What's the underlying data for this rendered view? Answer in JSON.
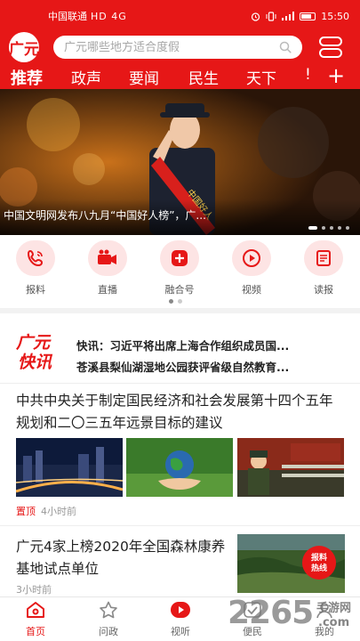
{
  "status_bar": {
    "carrier": "中国联通",
    "network": "HD 4G",
    "time": "15:50"
  },
  "header": {
    "logo_text": "广元",
    "search_placeholder": "广元哪些地方适合度假",
    "tabs": [
      {
        "label": "推荐",
        "active": true
      },
      {
        "label": "政声",
        "active": false
      },
      {
        "label": "要闻",
        "active": false
      },
      {
        "label": "民生",
        "active": false
      },
      {
        "label": "天下",
        "active": false
      },
      {
        "label": "!",
        "active": false
      }
    ],
    "more_label": "+"
  },
  "banner": {
    "caption": "中国文明网发布八九月“中国好人榜”，广...",
    "sash_text": "中国好人",
    "page_count": 5,
    "current_page": 1
  },
  "quick_actions": [
    {
      "label": "报料",
      "icon": "phone-icon"
    },
    {
      "label": "直播",
      "icon": "video-camera-icon"
    },
    {
      "label": "融合号",
      "icon": "plus-icon"
    },
    {
      "label": "视频",
      "icon": "play-icon"
    },
    {
      "label": "读报",
      "icon": "newspaper-icon"
    }
  ],
  "flash": {
    "logo_line1": "广元",
    "logo_line2": "快讯",
    "items": [
      "快讯：习近平将出席上海合作组织成员国...",
      "苍溪县梨仙湖湿地公园获评省级自然教育..."
    ]
  },
  "articles": [
    {
      "title": "中共中央关于制定国民经济和社会发展第十四个五年规划和二〇三五年远景目标的建议",
      "tag": "置顶",
      "time": "4小时前"
    },
    {
      "title": "广元4家上榜2020年全国森林康养基地试点单位",
      "tag": "",
      "time": "3小时前",
      "thumb_badge": "报料热线"
    }
  ],
  "bottom_nav": [
    {
      "label": "首页",
      "icon": "home-icon",
      "active": true
    },
    {
      "label": "问政",
      "icon": "star-icon",
      "active": false
    },
    {
      "label": "视听",
      "icon": "play-circle-icon",
      "active": false
    },
    {
      "label": "便民",
      "icon": "check-icon",
      "active": false
    },
    {
      "label": "我的",
      "icon": "user-icon",
      "active": false
    }
  ],
  "watermark": {
    "brand": "2265",
    "suffix": ".com",
    "site": "手游网"
  },
  "colors": {
    "brand_red": "#e61717",
    "light_red": "#fde4e4"
  }
}
